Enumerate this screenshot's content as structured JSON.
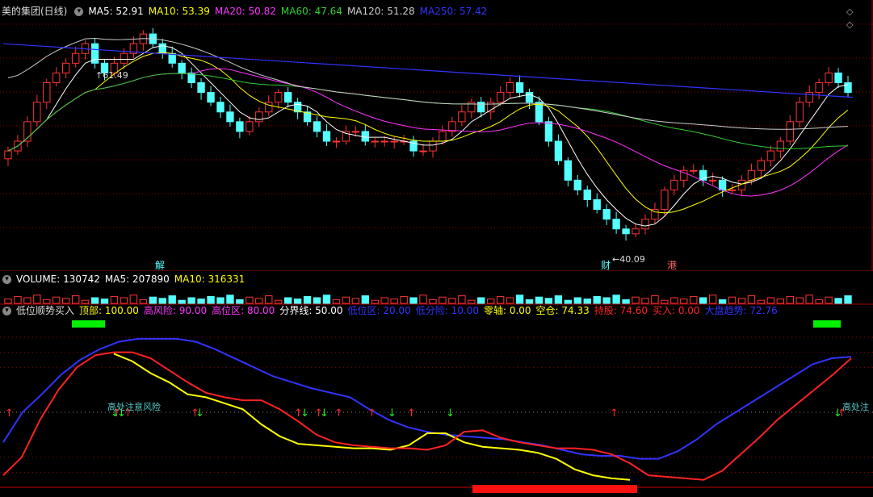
{
  "header": {
    "title": "美的集团(日线)",
    "ma": [
      {
        "label": "MA5: 52.91",
        "color": "#ffffff"
      },
      {
        "label": "MA10: 53.39",
        "color": "#ffff00"
      },
      {
        "label": "MA20: 50.82",
        "color": "#ff33ff"
      },
      {
        "label": "MA60: 47.64",
        "color": "#33cc33"
      },
      {
        "label": "MA120: 51.28",
        "color": "#cccccc"
      },
      {
        "label": "MA250: 57.42",
        "color": "#3333ff"
      }
    ]
  },
  "volume_header": {
    "items": [
      {
        "label": "VOLUME: 130742",
        "color": "#ffffff"
      },
      {
        "label": "MA5: 207890",
        "color": "#ffffff"
      },
      {
        "label": "MA10: 316331",
        "color": "#ffff00"
      }
    ]
  },
  "indicator_header": {
    "name": "低位顺势买入",
    "items": [
      {
        "label": "顶部: 100.00",
        "color": "#ffff00"
      },
      {
        "label": "高风险: 90.00",
        "color": "#ff33ff"
      },
      {
        "label": "高位区: 80.00",
        "color": "#ff33ff"
      },
      {
        "label": "分界线: 50.00",
        "color": "#ffffff"
      },
      {
        "label": "低位区: 20.00",
        "color": "#3333ff"
      },
      {
        "label": "低分险: 10.00",
        "color": "#3333ff"
      },
      {
        "label": "零轴: 0.00",
        "color": "#ffff00"
      },
      {
        "label": "空仓: 74.33",
        "color": "#ffff00"
      },
      {
        "label": "持股: 74.60",
        "color": "#ff2222"
      },
      {
        "label": "买入: 0.00",
        "color": "#ff2222"
      },
      {
        "label": "大盘趋势: 72.76",
        "color": "#3333ff"
      }
    ]
  },
  "annotations": {
    "high": "61.49",
    "low": "40.09",
    "event_jie": "解",
    "event_cai": "财",
    "event_gang": "港",
    "risk_text": "高处注意风险",
    "risk_text_right": "高处注"
  },
  "colors": {
    "up": "#ff3333",
    "down": "#54ffff",
    "grid": "#8b0000",
    "ma5": "#ffffff",
    "ma10": "#ffff00",
    "ma20": "#ff33ff",
    "ma60": "#33cc33",
    "ma120": "#cccccc",
    "ma250": "#3333ff"
  },
  "chart_data": [
    {
      "type": "candlestick",
      "title": "美的集团(日线)",
      "high_label": 61.49,
      "low_label": 40.09,
      "close": [
        49,
        50,
        52,
        54,
        56,
        57,
        58,
        59,
        60,
        58,
        57,
        58,
        59,
        60,
        61,
        60,
        59,
        58,
        57,
        56,
        55,
        54,
        53,
        52,
        51,
        52,
        53,
        54,
        55,
        54,
        53,
        52,
        51,
        50,
        50,
        51,
        51,
        50,
        50,
        50,
        50,
        50,
        49,
        49,
        50,
        51,
        52,
        53,
        54,
        53,
        54,
        55,
        56,
        55,
        54,
        52,
        50,
        48,
        46,
        45,
        44,
        43,
        42,
        41,
        40.5,
        41,
        42,
        43,
        45,
        46,
        47,
        47,
        46,
        46,
        45,
        45,
        46,
        47,
        48,
        49,
        50,
        52,
        54,
        55,
        56,
        57,
        56,
        55
      ],
      "ma250_start": 60,
      "ma250_end": 54.5
    },
    {
      "type": "bar",
      "title": "VOLUME",
      "values": {
        "VOLUME": 130742,
        "MA5": 207890,
        "MA10": 316331
      }
    },
    {
      "type": "line",
      "title": "低位顺势买入",
      "ylim": [
        0,
        100
      ],
      "reference_lines": [
        100,
        90,
        80,
        50,
        20,
        10,
        0
      ],
      "series": [
        {
          "name": "大盘趋势",
          "color": "#3333ff",
          "values": [
            30,
            50,
            62,
            75,
            85,
            92,
            97,
            99,
            99,
            99,
            97,
            92,
            86,
            80,
            74,
            70,
            66,
            63,
            60,
            52,
            45,
            40,
            37,
            35,
            34,
            33,
            32,
            30,
            28,
            25,
            22,
            21,
            21,
            19,
            19,
            24,
            32,
            42,
            50,
            58,
            66,
            74,
            82,
            86,
            87
          ]
        },
        {
          "name": "持股",
          "color": "#ff2222",
          "values": [
            8,
            20,
            45,
            65,
            80,
            88,
            90,
            90,
            86,
            78,
            70,
            63,
            60,
            58,
            58,
            52,
            44,
            35,
            30,
            28,
            27,
            26,
            26,
            25,
            28,
            37,
            38,
            33,
            30,
            28,
            26,
            26,
            25,
            22,
            16,
            8,
            7,
            6,
            5,
            11,
            22,
            33,
            45,
            55,
            65,
            75,
            86
          ]
        },
        {
          "name": "空仓",
          "color": "#ffff00",
          "values": [
            null,
            null,
            null,
            null,
            null,
            null,
            89,
            84,
            76,
            70,
            62,
            60,
            56,
            52,
            42,
            34,
            29,
            28,
            27,
            26,
            26,
            25,
            28,
            36,
            36,
            30,
            27,
            26,
            25,
            23,
            19,
            12,
            8,
            6,
            5
          ]
        }
      ]
    }
  ]
}
